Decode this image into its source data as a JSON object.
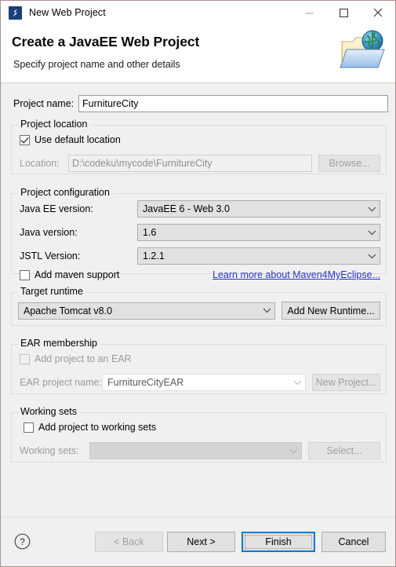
{
  "window": {
    "title": "New Web Project",
    "icon": "myeclipse-logo-icon",
    "minimize_label": "Minimize",
    "maximize_label": "Maximize",
    "close_label": "Close"
  },
  "banner": {
    "title": "Create a JavaEE Web Project",
    "subtitle": "Specify project name and other details",
    "icon": "web-project-folder-globe-icon"
  },
  "project_name": {
    "label": "Project name:",
    "value": "FurnitureCity",
    "placeholder": ""
  },
  "project_location": {
    "group_label": "Project location",
    "use_default_label": "Use default location",
    "use_default_checked": true,
    "location_label": "Location:",
    "location_value": "D:\\codeku\\mycode\\FurnitureCity",
    "browse_label": "Browse..."
  },
  "project_configuration": {
    "group_label": "Project configuration",
    "javaee_label": "Java EE version:",
    "javaee_value": "JavaEE 6 - Web 3.0",
    "java_label": "Java version:",
    "java_value": "1.6",
    "jstl_label": "JSTL Version:",
    "jstl_value": "1.2.1",
    "maven_label": "Add maven support",
    "maven_checked": false,
    "maven_link": "Learn more about Maven4MyEclipse..."
  },
  "target_runtime": {
    "group_label": "Target runtime",
    "value": "Apache Tomcat v8.0",
    "add_runtime_label": "Add New Runtime..."
  },
  "ear_membership": {
    "group_label": "EAR membership",
    "add_to_ear_label": "Add project to an EAR",
    "add_to_ear_checked": false,
    "ear_name_label": "EAR project name:",
    "ear_name_value": "FurnitureCityEAR",
    "new_project_label": "New Project..."
  },
  "working_sets": {
    "group_label": "Working sets",
    "add_to_ws_label": "Add project to working sets",
    "add_to_ws_checked": false,
    "ws_label": "Working sets:",
    "ws_value": "",
    "select_label": "Select..."
  },
  "buttons": {
    "help": "?",
    "back": "< Back",
    "next": "Next >",
    "finish": "Finish",
    "cancel": "Cancel"
  },
  "colors": {
    "accent": "#0078d7",
    "link": "#2a36c8",
    "window_border": "#b09090",
    "dialog_bg": "#f0f0f0",
    "control_bg": "#e1e1e1"
  }
}
